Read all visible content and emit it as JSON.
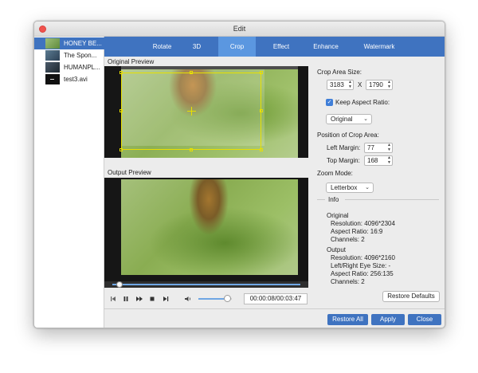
{
  "window": {
    "title": "Edit"
  },
  "sidebar": {
    "items": [
      {
        "label": "HONEY BE...",
        "active": true
      },
      {
        "label": "The Spon..."
      },
      {
        "label": "HUMANPL..."
      },
      {
        "label": "test3.avi"
      }
    ]
  },
  "tabs": [
    "Rotate",
    "3D",
    "Crop",
    "Effect",
    "Enhance",
    "Watermark"
  ],
  "active_tab": "Crop",
  "preview": {
    "original_label": "Original Preview",
    "output_label": "Output Preview"
  },
  "player": {
    "time": "00:00:08/00:03:47",
    "progress": 0.03,
    "volume": 0.85
  },
  "crop": {
    "area_size_label": "Crop Area Size:",
    "width": "3183",
    "x_label": "X",
    "height": "1790",
    "keep_aspect_label": "Keep Aspect Ratio:",
    "keep_aspect_checked": true,
    "aspect_value": "Original",
    "position_label": "Position of Crop Area:",
    "left_margin_label": "Left Margin:",
    "left_margin": "77",
    "top_margin_label": "Top Margin:",
    "top_margin": "168",
    "zoom_label": "Zoom Mode:",
    "zoom_value": "Letterbox"
  },
  "info": {
    "heading": "Info",
    "original_heading": "Original",
    "orig_resolution": "Resolution: 4096*2304",
    "orig_aspect": "Aspect Ratio: 16:9",
    "orig_channels": "Channels: 2",
    "output_heading": "Output",
    "out_resolution": "Resolution: 4096*2160",
    "out_eye": "Left/Right Eye Size: -",
    "out_aspect": "Aspect Ratio: 256:135",
    "out_channels": "Channels: 2"
  },
  "buttons": {
    "restore_defaults": "Restore Defaults",
    "restore_all": "Restore All",
    "apply": "Apply",
    "close": "Close"
  },
  "colors": {
    "accent": "#3f73c0",
    "active_tab": "#5b97e0",
    "crop_outline": "#e8e000"
  }
}
